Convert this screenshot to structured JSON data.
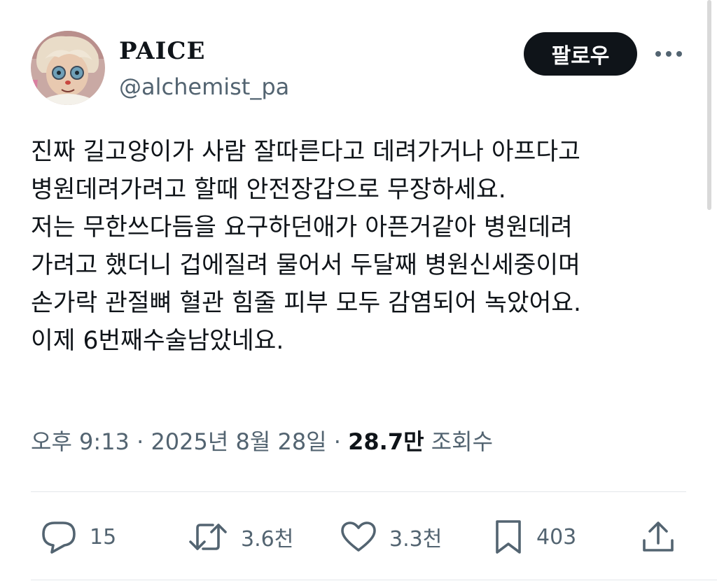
{
  "author": {
    "display_name": "PAICE",
    "handle": "@alchemist_pa"
  },
  "follow_label": "팔로우",
  "tweet_lines": [
    "진짜 길고양이가 사람 잘따른다고 데려가거나 아프다고",
    "병원데려가려고 할때 안전장갑으로 무장하세요.",
    "저는 무한쓰다듬을 요구하던애가 아픈거같아 병원데려",
    "가려고 했더니 겁에질려 물어서 두달째 병원신세중이며",
    "손가락 관절뼈 혈관 힘줄 피부 모두 감염되어 녹았어요.",
    "이제 6번째수술남았네요."
  ],
  "meta": {
    "time": "오후 9:13",
    "separator": "·",
    "date": "2025년 8월 28일",
    "views_count": "28.7만",
    "views_label": "조회수"
  },
  "actions": {
    "replies": "15",
    "retweets": "3.6천",
    "likes": "3.3천",
    "bookmarks": "403"
  },
  "colors": {
    "text_primary": "#0f1419",
    "text_secondary": "#536471",
    "divider": "#e3e7ea",
    "button_bg": "#0f1419"
  },
  "icons": {
    "reply": "speech-bubble-icon",
    "retweet": "retweet-arrows-icon",
    "like": "heart-icon",
    "bookmark": "bookmark-icon",
    "share": "share-upload-icon",
    "more": "three-dots-icon"
  }
}
